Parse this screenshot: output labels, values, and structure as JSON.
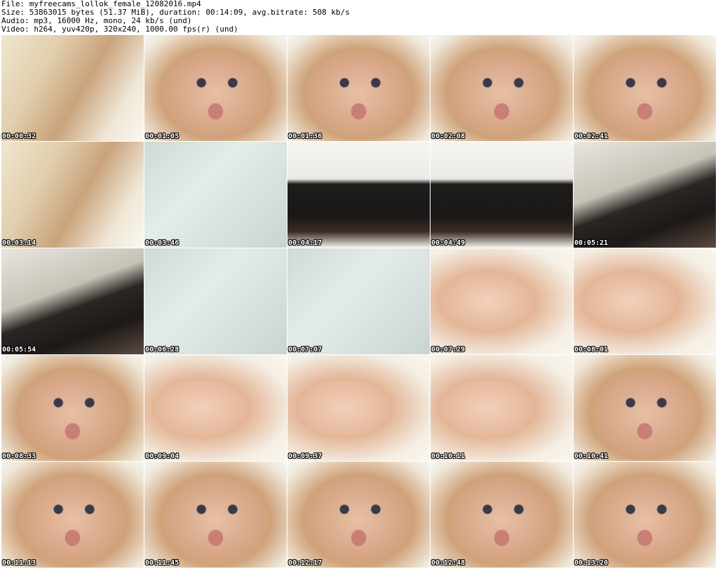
{
  "header": {
    "file": "File: myfreecams_lollok_female_12082016.mp4",
    "size": "Size: 53863015 bytes (51.37 MiB), duration: 00:14:09, avg.bitrate: 508 kb/s",
    "audio": "Audio: mp3, 16000 Hz, mono, 24 kb/s (und)",
    "video": "Video: h264, yuv420p, 320x240, 1000.00 fps(r) (und)"
  },
  "thumbnails": [
    {
      "timestamp": "00:00:32"
    },
    {
      "timestamp": "00:01:05"
    },
    {
      "timestamp": "00:01:36"
    },
    {
      "timestamp": "00:02:08"
    },
    {
      "timestamp": "00:02:41"
    },
    {
      "timestamp": "00:03:14"
    },
    {
      "timestamp": "00:03:46"
    },
    {
      "timestamp": "00:04:17"
    },
    {
      "timestamp": "00:04:49"
    },
    {
      "timestamp": "00:05:21"
    },
    {
      "timestamp": "00:05:54"
    },
    {
      "timestamp": "00:06:28"
    },
    {
      "timestamp": "00:07:07"
    },
    {
      "timestamp": "00:07:29"
    },
    {
      "timestamp": "00:08:01"
    },
    {
      "timestamp": "00:08:33"
    },
    {
      "timestamp": "00:09:04"
    },
    {
      "timestamp": "00:09:37"
    },
    {
      "timestamp": "00:10:11"
    },
    {
      "timestamp": "00:10:41"
    },
    {
      "timestamp": "00:11:13"
    },
    {
      "timestamp": "00:11:45"
    },
    {
      "timestamp": "00:12:17"
    },
    {
      "timestamp": "00:12:48"
    },
    {
      "timestamp": "00:13:20"
    }
  ]
}
